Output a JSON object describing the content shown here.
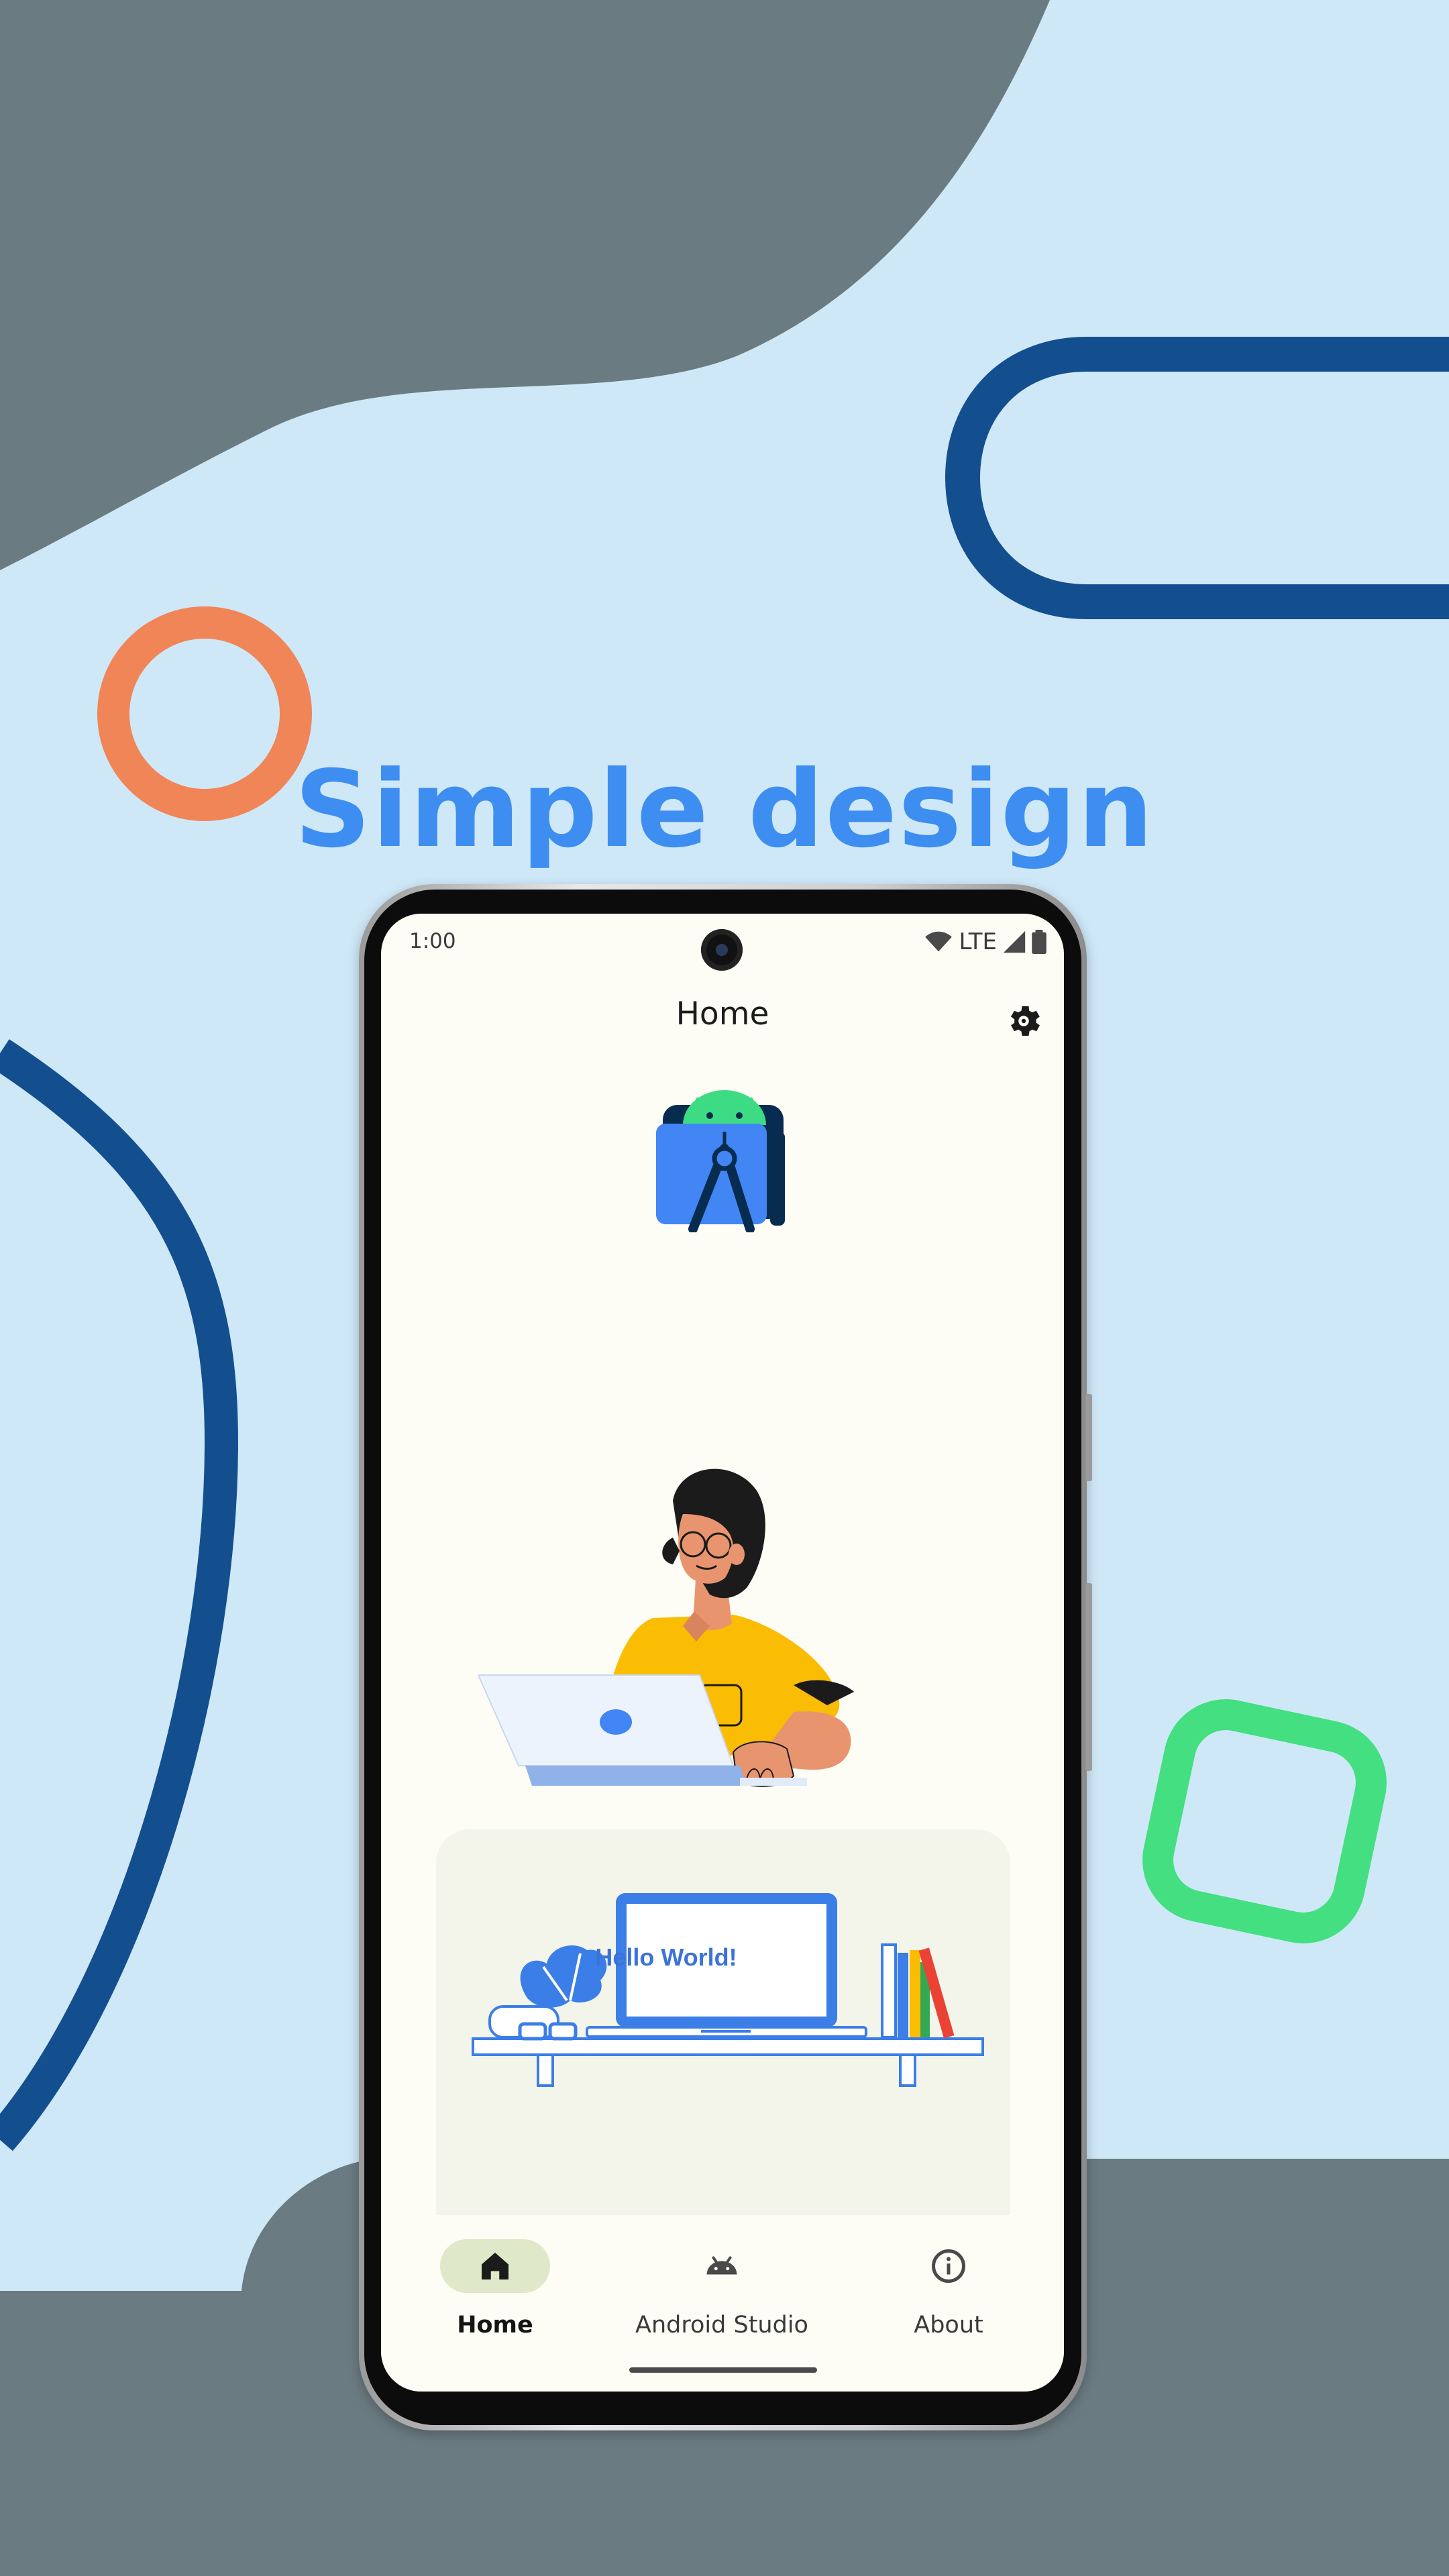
{
  "promo": {
    "headline": "Simple design",
    "colors": {
      "sky": "#cfe8f8",
      "slate": "#6b7b82",
      "navy": "#134f8f",
      "orange": "#f08557",
      "green": "#43df81",
      "headline": "#3d8ef0"
    }
  },
  "status_bar": {
    "time": "1:00",
    "network": "LTE",
    "icons": [
      "wifi-icon",
      "cellular-signal-icon",
      "battery-icon"
    ]
  },
  "app_bar": {
    "title": "Home",
    "action_icon": "gear-icon"
  },
  "content": {
    "logo_icon": "android-studio-logo",
    "illustration": "person-with-laptop",
    "card_screen_text": "Hello World!",
    "colors": {
      "screen_bg": "#fdfdf6",
      "card_bg": "#f3f5eb",
      "accent_blue": "#3b7ee8"
    }
  },
  "bottom_nav": {
    "active_index": 0,
    "items": [
      {
        "label": "Home",
        "icon": "home-icon"
      },
      {
        "label": "Android Studio",
        "icon": "android-icon"
      },
      {
        "label": "About",
        "icon": "info-icon"
      }
    ],
    "colors": {
      "indicator": "#dfe8c8",
      "nav_bg": "#fdfdf6"
    }
  }
}
